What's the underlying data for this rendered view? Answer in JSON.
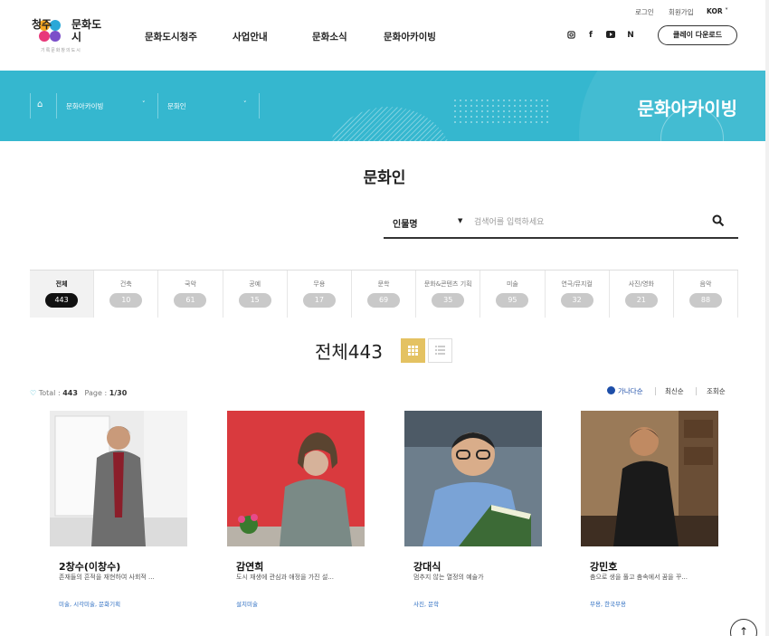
{
  "header": {
    "logo": {
      "line1": "청주",
      "line2": "문화도시",
      "subtitle": "기록문화창의도시"
    },
    "nav": [
      "문화도시청주",
      "사업안내",
      "문화소식",
      "문화아카이빙"
    ],
    "util": {
      "login": "로그인",
      "signup": "회원가입",
      "lang": "KOR ˅"
    },
    "social": [
      "instagram-icon",
      "facebook-icon",
      "youtube-icon",
      "naver-icon"
    ],
    "download": "클레이 다운로드"
  },
  "banner": {
    "breadcrumb": [
      "문화아카이빙",
      "문화인"
    ],
    "title": "문화아카이빙",
    "color": "#35b7cf"
  },
  "main": {
    "title": "문화인",
    "search": {
      "select": "인물명",
      "placeholder": "검색어를 입력하세요"
    },
    "tabs": [
      {
        "label": "전체",
        "count": "443"
      },
      {
        "label": "건축",
        "count": "10"
      },
      {
        "label": "국악",
        "count": "61"
      },
      {
        "label": "공예",
        "count": "15"
      },
      {
        "label": "무용",
        "count": "17"
      },
      {
        "label": "문학",
        "count": "69"
      },
      {
        "label": "문화&콘텐츠 기획",
        "count": "35"
      },
      {
        "label": "미술",
        "count": "95"
      },
      {
        "label": "연극/뮤지컬",
        "count": "32"
      },
      {
        "label": "사진/영화",
        "count": "21"
      },
      {
        "label": "음악",
        "count": "88"
      }
    ],
    "section_title": "전체443",
    "total": {
      "label": "Total : ",
      "value": "443",
      "page_label": "Page : ",
      "page_value": "1/30"
    },
    "sort": [
      "가나다순",
      "최신순",
      "조회순"
    ],
    "cards": [
      {
        "name": "2창수(이창수)",
        "desc": "존재들의 흔적을 재현하여 사회적 ...",
        "tags": "미술, 시각미술, 문화기획"
      },
      {
        "name": "감연희",
        "desc": "도시 재생에 관심과 애정을 가진 설...",
        "tags": "설치미술"
      },
      {
        "name": "강대식",
        "desc": "멈추지 않는 열정의 예술가",
        "tags": "사진, 문학"
      },
      {
        "name": "강민호",
        "desc": "춤으로 생을 풀고 춤속에서 꿈을 꾸...",
        "tags": "무용, 한국무용"
      }
    ]
  }
}
